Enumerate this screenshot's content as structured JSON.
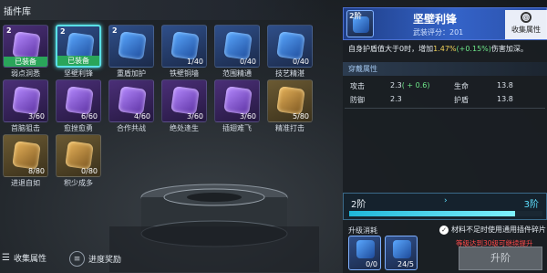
{
  "library": {
    "title": "插件库"
  },
  "cards": [
    {
      "level": "2",
      "count": "",
      "equipped": true,
      "equipped_label": "已装备",
      "name": "弱点洞悉",
      "rarity": "purple",
      "selected": false
    },
    {
      "level": "2",
      "count": "",
      "equipped": true,
      "equipped_label": "已装备",
      "name": "坚壁利锋",
      "rarity": "blue",
      "selected": true
    },
    {
      "level": "2",
      "count": "",
      "equipped": false,
      "equipped_label": "",
      "name": "重盾加护",
      "rarity": "blue",
      "selected": false
    },
    {
      "level": "",
      "count": "1/40",
      "equipped": false,
      "equipped_label": "",
      "name": "铁壁铜墙",
      "rarity": "blue",
      "selected": false
    },
    {
      "level": "",
      "count": "0/40",
      "equipped": false,
      "equipped_label": "",
      "name": "范围精通",
      "rarity": "blue",
      "selected": false
    },
    {
      "level": "",
      "count": "0/40",
      "equipped": false,
      "equipped_label": "",
      "name": "技艺精湛",
      "rarity": "blue",
      "selected": false
    },
    {
      "level": "",
      "count": "3/60",
      "equipped": false,
      "equipped_label": "",
      "name": "首脑狙击",
      "rarity": "purple",
      "selected": false
    },
    {
      "level": "",
      "count": "6/60",
      "equipped": false,
      "equipped_label": "",
      "name": "愈挫愈勇",
      "rarity": "purple",
      "selected": false
    },
    {
      "level": "",
      "count": "4/60",
      "equipped": false,
      "equipped_label": "",
      "name": "合作共战",
      "rarity": "purple",
      "selected": false
    },
    {
      "level": "",
      "count": "3/60",
      "equipped": false,
      "equipped_label": "",
      "name": "绝处逢生",
      "rarity": "purple",
      "selected": false
    },
    {
      "level": "",
      "count": "3/60",
      "equipped": false,
      "equipped_label": "",
      "name": "插翅难飞",
      "rarity": "purple",
      "selected": false
    },
    {
      "level": "",
      "count": "5/80",
      "equipped": false,
      "equipped_label": "",
      "name": "精准打击",
      "rarity": "gold",
      "selected": false
    },
    {
      "level": "",
      "count": "8/80",
      "equipped": false,
      "equipped_label": "",
      "name": "进退自如",
      "rarity": "gold",
      "selected": false
    },
    {
      "level": "",
      "count": "0/80",
      "equipped": false,
      "equipped_label": "",
      "name": "积少成多",
      "rarity": "gold",
      "selected": false
    }
  ],
  "bottom_bar": {
    "collect_label": "收集属性",
    "progress_label": "进度奖励"
  },
  "detail": {
    "level": "2阶",
    "title": "坚壁利锋",
    "score": "武装评分：201",
    "collect_label": "收集属性",
    "desc_prefix": "自身护盾值大于0时，增加",
    "desc_value": "1.47%",
    "desc_bonus": "(+0.15%)",
    "desc_suffix": "伤害加深。",
    "attr_title": "穿戴属性",
    "attrs": {
      "attack_label": "攻击",
      "attack_value": "2.3",
      "attack_bonus": "( + 0.6)",
      "defense_label": "防御",
      "defense_value": "2.3",
      "hp_label": "生命",
      "hp_value": "13.8",
      "shield_label": "护盾",
      "shield_value": "13.8"
    },
    "tier_from": "2阶",
    "tier_to": "3阶",
    "tier_progress": 0.86,
    "cost_title": "升级消耗",
    "use_generic_label": "材料不足时使用通用插件碎片",
    "materials": [
      {
        "count": "0/0"
      },
      {
        "count": "24/5"
      }
    ],
    "warning": "等级达到30级可继续提升",
    "upgrade_label": "升阶"
  }
}
